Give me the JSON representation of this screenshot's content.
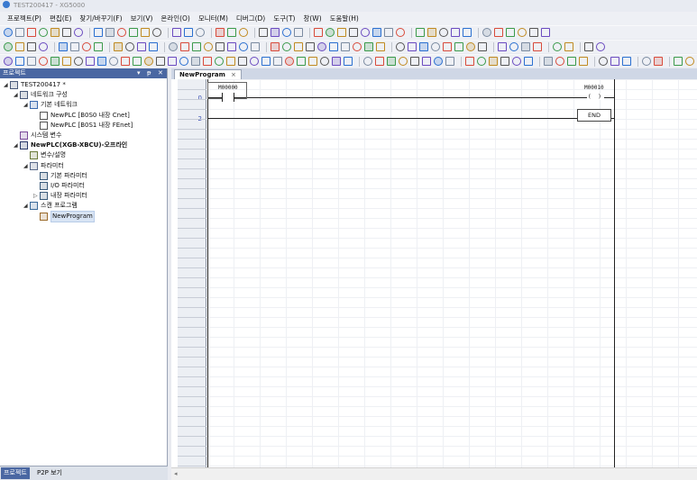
{
  "window": {
    "title": "TEST200417 - XG5000"
  },
  "menu": [
    "프로젝트(P)",
    "편집(E)",
    "찾기/바꾸기(F)",
    "보기(V)",
    "온라인(O)",
    "모니터(M)",
    "디버그(D)",
    "도구(T)",
    "창(W)",
    "도움말(H)"
  ],
  "project_panel": {
    "title": "프로젝트",
    "tree": [
      {
        "label": "TEST200417 *",
        "icon": "project-icon",
        "level": 0,
        "toggle": "◢"
      },
      {
        "label": "네트워크 구성",
        "icon": "network-icon",
        "level": 1,
        "toggle": "◢"
      },
      {
        "label": "기본 네트워크",
        "icon": "network-folder-icon",
        "level": 2,
        "toggle": "◢"
      },
      {
        "label": "NewPLC [B0S0 내장 Cnet]",
        "icon": "plc-link-icon",
        "level": 3,
        "toggle": ""
      },
      {
        "label": "NewPLC [B0S1 내장 FEnet]",
        "icon": "plc-link-icon",
        "level": 3,
        "toggle": ""
      },
      {
        "label": "시스템 변수",
        "icon": "system-variable-icon",
        "level": 1,
        "toggle": ""
      },
      {
        "label": "NewPLC(XGB-XBCU)-오프라인",
        "icon": "plc-icon",
        "level": 1,
        "toggle": "◢",
        "bold": true
      },
      {
        "label": "변수/설명",
        "icon": "variable-icon",
        "level": 2,
        "toggle": ""
      },
      {
        "label": "파라미터",
        "icon": "parameter-folder-icon",
        "level": 2,
        "toggle": "◢"
      },
      {
        "label": "기본 파라미터",
        "icon": "parameter-icon",
        "level": 3,
        "toggle": ""
      },
      {
        "label": "I/O 파라미터",
        "icon": "parameter-icon",
        "level": 3,
        "toggle": ""
      },
      {
        "label": "내장 파라미터",
        "icon": "parameter-icon",
        "level": 3,
        "toggle": "▷"
      },
      {
        "label": "스캔 프로그램",
        "icon": "scan-program-icon",
        "level": 2,
        "toggle": "◢"
      },
      {
        "label": "NewProgram",
        "icon": "program-icon",
        "level": 3,
        "toggle": "",
        "selected": true
      }
    ],
    "bottom_tabs": [
      "프로젝트",
      "P2P 보기"
    ]
  },
  "editor": {
    "tab_label": "NewProgram",
    "tab_close": "×",
    "row_numbers": [
      "0",
      "2"
    ],
    "contact": {
      "device": "M00000"
    },
    "coil": {
      "device": "M00010",
      "symbol": "( )"
    },
    "end_label": "END"
  },
  "colors": {
    "panel_header": "#4a67a2",
    "row_number": "#3a4fb3",
    "background": "#e8eaf0"
  }
}
